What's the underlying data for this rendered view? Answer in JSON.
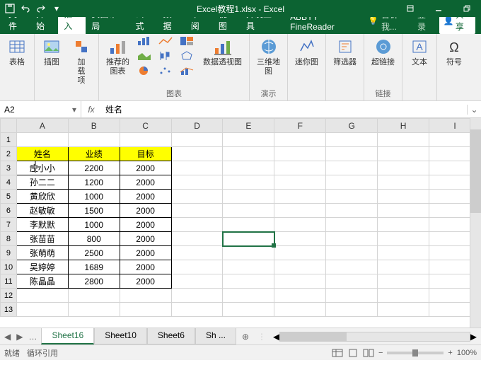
{
  "title": "Excel教程1.xlsx - Excel",
  "tabs": [
    "文件",
    "开始",
    "插入",
    "页面布局",
    "公式",
    "数据",
    "审阅",
    "视图",
    "开发工具",
    "ABBYY FineReader"
  ],
  "active_tab": 2,
  "tellme": "告诉我...",
  "login": "登录",
  "share": "共享",
  "ribbon": {
    "tables": {
      "cells": "表格",
      "pic": "插图",
      "addins": "加\n载\n项",
      "recchart": "推荐的\n图表",
      "pivotchart": "数据透视图",
      "map3d": "三维地\n图",
      "sparkline": "迷你图",
      "filter": "筛选器",
      "hyperlink": "超链接",
      "text": "文本",
      "symbol": "符号"
    },
    "groups": {
      "charts": "图表",
      "demo": "演示",
      "links": "链接"
    }
  },
  "namebox": "A2",
  "formula": "姓名",
  "columns": [
    "A",
    "B",
    "C",
    "D",
    "E",
    "F",
    "G",
    "H",
    "I"
  ],
  "headers": [
    "姓名",
    "业绩",
    "目标"
  ],
  "rows": [
    [
      "庄小小",
      "2200",
      "2000"
    ],
    [
      "孙二二",
      "1200",
      "2000"
    ],
    [
      "黄欣欣",
      "1000",
      "2000"
    ],
    [
      "赵敏敏",
      "1500",
      "2000"
    ],
    [
      "李默默",
      "1000",
      "2000"
    ],
    [
      "张苗苗",
      "800",
      "2000"
    ],
    [
      "张萌萌",
      "2500",
      "2000"
    ],
    [
      "吴婷婷",
      "1689",
      "2000"
    ],
    [
      "陈晶晶",
      "2800",
      "2000"
    ]
  ],
  "selected_cell": {
    "row": 8,
    "col": "E"
  },
  "sheets": [
    "Sheet16",
    "Sheet10",
    "Sheet6",
    "Sh ..."
  ],
  "active_sheet": 0,
  "status_left1": "就绪",
  "status_left2": "循环引用",
  "zoom": "100%"
}
